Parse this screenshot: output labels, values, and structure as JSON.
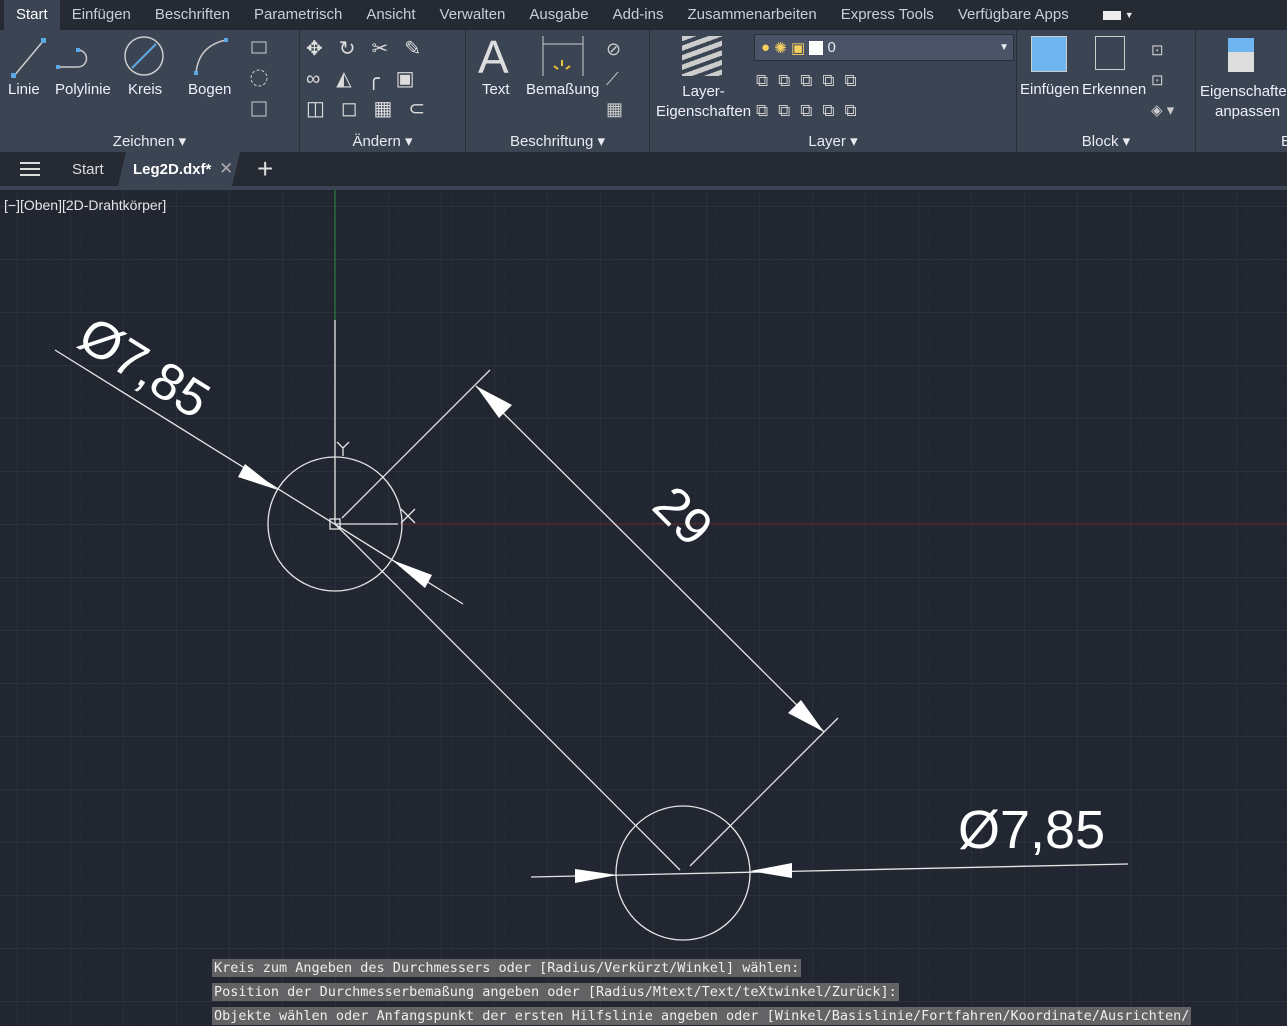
{
  "ribbon_tabs": [
    "Start",
    "Einfügen",
    "Beschriften",
    "Parametrisch",
    "Ansicht",
    "Verwalten",
    "Ausgabe",
    "Add-ins",
    "Zusammenarbeiten",
    "Express Tools",
    "Verfügbare Apps"
  ],
  "active_tab": "Start",
  "panels": {
    "zeichnen": {
      "label": "Zeichnen",
      "tools": [
        "Linie",
        "Polylinie",
        "Kreis",
        "Bogen"
      ]
    },
    "aendern": {
      "label": "Ändern"
    },
    "beschriftung": {
      "label": "Beschriftung",
      "tools": [
        "Text",
        "Bemaßung"
      ]
    },
    "layer": {
      "label": "Layer",
      "tool_line1": "Layer-",
      "tool_line2": "Eigenschaften",
      "current_layer": "0"
    },
    "block": {
      "label": "Block",
      "tools": [
        "Einfügen",
        "Erkennen"
      ]
    },
    "eigen": {
      "line1": "Eigenschaften",
      "line2": "anpassen",
      "label": "E"
    }
  },
  "doc_tabs": {
    "start": "Start",
    "active": "Leg2D.dxf*"
  },
  "viewport_label": "[−][Oben][2D-Drahtkörper]",
  "drawing": {
    "dim1": "Ø7,85",
    "dim2": "Ø7,85",
    "dim3": "29"
  },
  "command_lines": [
    "Kreis zum Angeben des Durchmessers oder [Radius/Verkürzt/Winkel] wählen:",
    "Position der Durchmesserbemaßung angeben oder [Radius/Mtext/Text/teXtwinkel/Zurück]:",
    "Objekte wählen oder Anfangspunkt der ersten Hilfslinie angeben oder [Winkel/Basislinie/Fortfahren/Koordinate/Ausrichten/"
  ],
  "colors": {
    "canvas": "#212630",
    "ribbon": "#3b4453",
    "accent": "#5aa9e6",
    "x_axis": "#8a2a2a",
    "y_axis": "#2f8f3a"
  }
}
